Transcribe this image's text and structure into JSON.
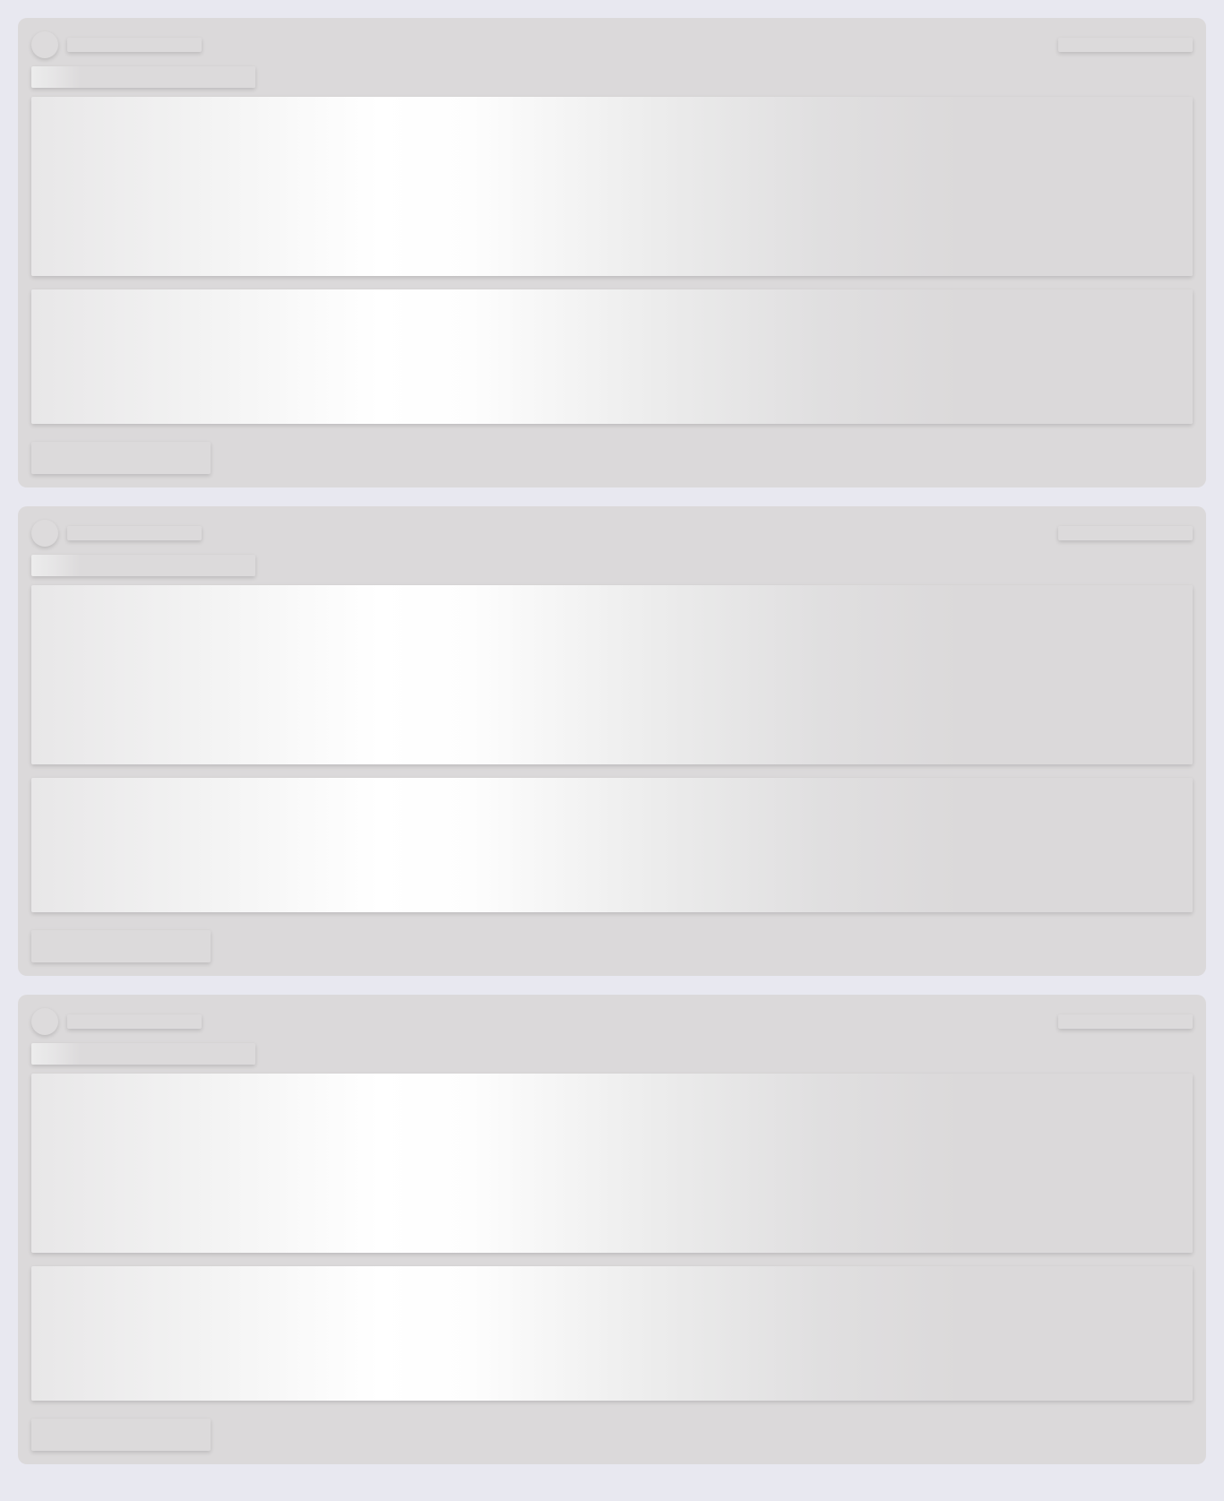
{
  "state": "loading",
  "feed": {
    "placeholder_cards": 3
  },
  "colors": {
    "page_background": "#e8e8f0",
    "card_background": "#dbd9da",
    "shimmer_highlight": "#ffffff"
  }
}
